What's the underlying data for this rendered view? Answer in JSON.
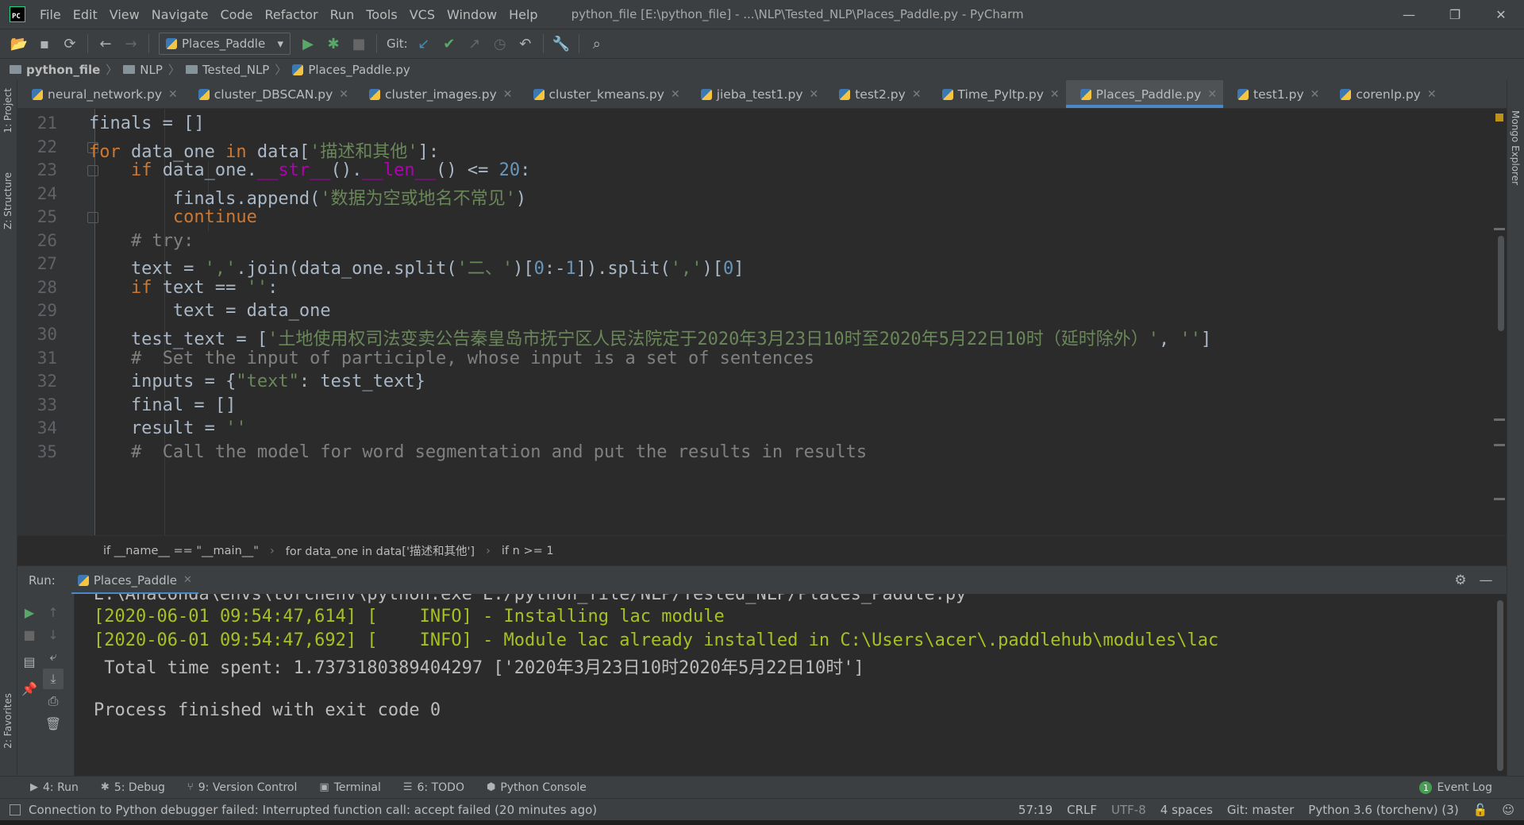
{
  "window": {
    "title": "python_file [E:\\python_file] - ...\\NLP\\Tested_NLP\\Places_Paddle.py - PyCharm",
    "logo": "PC",
    "controls": [
      "—",
      "❐",
      "✕"
    ]
  },
  "menu": [
    "File",
    "Edit",
    "View",
    "Navigate",
    "Code",
    "Refactor",
    "Run",
    "Tools",
    "VCS",
    "Window",
    "Help"
  ],
  "toolbar": {
    "run_config": "Places_Paddle",
    "git_label": "Git:"
  },
  "breadcrumb": [
    "python_file",
    "NLP",
    "Tested_NLP",
    "Places_Paddle.py"
  ],
  "side_tabs": {
    "project": "1: Project",
    "structure": "Z: Structure",
    "favorites": "2: Favorites",
    "mongo": "Mongo Explorer"
  },
  "tabs": [
    {
      "label": "neural_network.py",
      "active": false
    },
    {
      "label": "cluster_DBSCAN.py",
      "active": false
    },
    {
      "label": "cluster_images.py",
      "active": false
    },
    {
      "label": "cluster_kmeans.py",
      "active": false
    },
    {
      "label": "jieba_test1.py",
      "active": false
    },
    {
      "label": "test2.py",
      "active": false
    },
    {
      "label": "Time_Pyltp.py",
      "active": false
    },
    {
      "label": "Places_Paddle.py",
      "active": true
    },
    {
      "label": "test1.py",
      "active": false
    },
    {
      "label": "corenlp.py",
      "active": false
    }
  ],
  "editor": {
    "line_numbers": [
      "21",
      "22",
      "23",
      "24",
      "25",
      "26",
      "27",
      "28",
      "29",
      "30",
      "31",
      "32",
      "33",
      "34",
      "35"
    ]
  },
  "code_breadcrumbs": [
    "if __name__ == \"__main__\"",
    "for data_one in data['描述和其他']",
    "if n >= 1"
  ],
  "run_panel": {
    "label": "Run:",
    "tab": "Places_Paddle",
    "console": [
      "E:\\Anaconda\\envs\\torchenv\\python.exe E:/python_file/NLP/Tested_NLP/Places_Paddle.py",
      "[2020-06-01 09:54:47,614] [    INFO] - Installing lac module",
      "[2020-06-01 09:54:47,692] [    INFO] - Module lac already installed in C:\\Users\\acer\\.paddlehub\\modules\\lac",
      " Total time spent: 1.7373180389404297 ['2020年3月23日10时2020年5月22日10时']",
      "",
      "Process finished with exit code 0"
    ]
  },
  "tool_windows": [
    {
      "label": "4: Run",
      "icon": "▶"
    },
    {
      "label": "5: Debug",
      "icon": "✱"
    },
    {
      "label": "9: Version Control",
      "icon": "⑂"
    },
    {
      "label": "Terminal",
      "icon": "▣"
    },
    {
      "label": "6: TODO",
      "icon": "☰"
    },
    {
      "label": "Python Console",
      "icon": "⬢"
    }
  ],
  "event_log": {
    "count": "1",
    "label": "Event Log"
  },
  "status": {
    "message": "Connection to Python debugger failed: Interrupted function call: accept failed (20 minutes ago)",
    "position": "57:19",
    "line_sep": "CRLF",
    "encoding": "UTF-8",
    "indent": "4 spaces",
    "vcs": "Git: master",
    "interpreter": "Python 3.6 (torchenv) (3)"
  },
  "colors": {
    "keyword": "#cc7832",
    "string": "#6a8759",
    "number": "#6897bb",
    "comment": "#808080",
    "accent": "#4a88c7",
    "console_info": "#a8c023"
  }
}
